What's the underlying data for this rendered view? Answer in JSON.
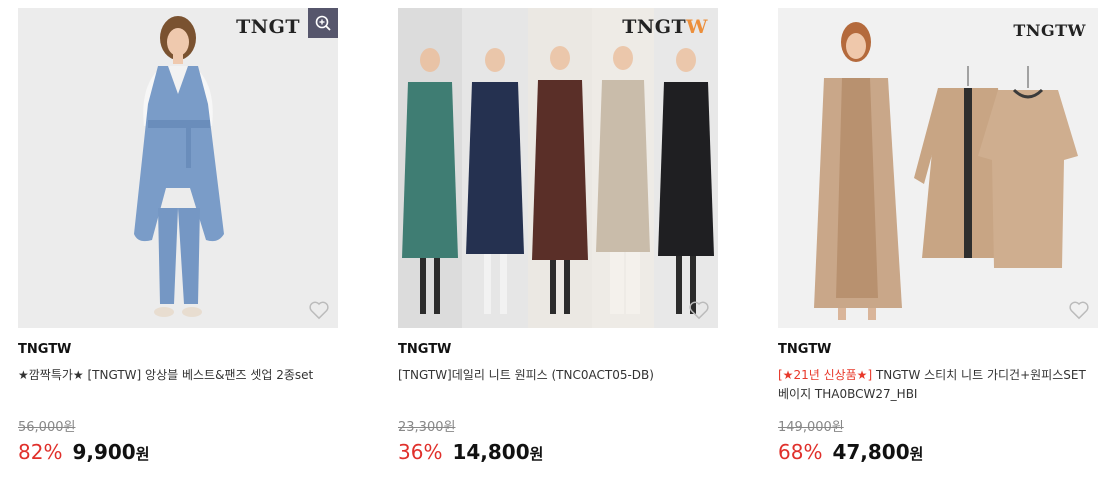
{
  "products": [
    {
      "logo": "TNGT",
      "brand": "TNGTW",
      "title": "★깜짝특가★ [TNGTW] 앙상블 베스트&팬즈 셋업 2종set",
      "original_price": "56,000원",
      "discount": "82%",
      "price": "9,900",
      "currency": "원"
    },
    {
      "logo_main": "TNGT",
      "logo_accent": "W",
      "brand": "TNGTW",
      "title": "[TNGTW]데일리 니트 원피스 (TNC0ACT05-DB)",
      "original_price": "23,300원",
      "discount": "36%",
      "price": "14,800",
      "currency": "원"
    },
    {
      "logo": "TNGTW",
      "brand": "TNGTW",
      "title_highlight": "[★21년 신상품★]",
      "title_rest": " TNGTW 스티치 니트 가디건+원피스SET 베이지 THA0BCW27_HBI",
      "original_price": "149,000원",
      "discount": "68%",
      "price": "47,800",
      "currency": "원"
    }
  ],
  "colors": {
    "discount": "#e0302b",
    "zoom_bg": "#56566c",
    "logo_accent": "#ec8f3c"
  }
}
